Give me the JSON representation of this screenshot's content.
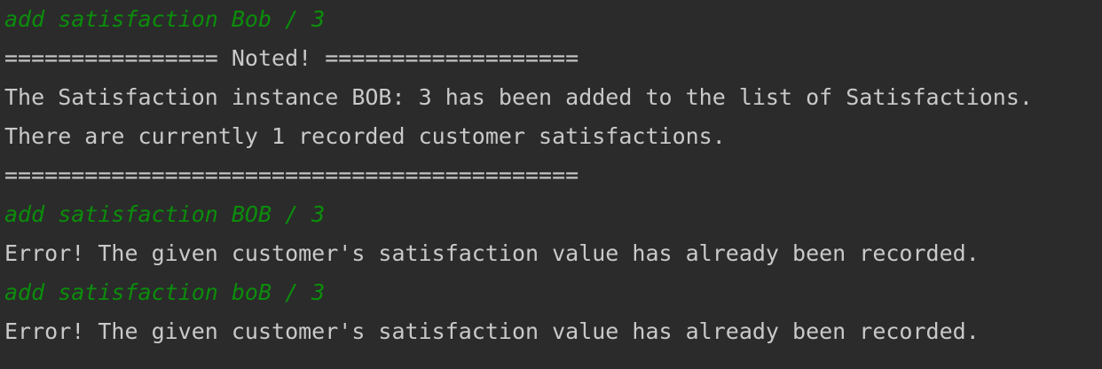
{
  "console": {
    "lines": [
      {
        "kind": "input",
        "text": "add satisfaction Bob / 3"
      },
      {
        "kind": "output",
        "text": "================ Noted! ==================="
      },
      {
        "kind": "output",
        "text": "The Satisfaction instance BOB: 3 has been added to the list of Satisfactions."
      },
      {
        "kind": "output",
        "text": "There are currently 1 recorded customer satisfactions."
      },
      {
        "kind": "output",
        "text": "==========================================="
      },
      {
        "kind": "input",
        "text": "add satisfaction BOB / 3"
      },
      {
        "kind": "output",
        "text": "Error! The given customer's satisfaction value has already been recorded."
      },
      {
        "kind": "input",
        "text": "add satisfaction boB / 3"
      },
      {
        "kind": "output",
        "text": "Error! The given customer's satisfaction value has already been recorded."
      }
    ]
  },
  "colors": {
    "background": "#2b2b2b",
    "input_text": "#0b8d0b",
    "output_text": "#c9c9c9"
  }
}
